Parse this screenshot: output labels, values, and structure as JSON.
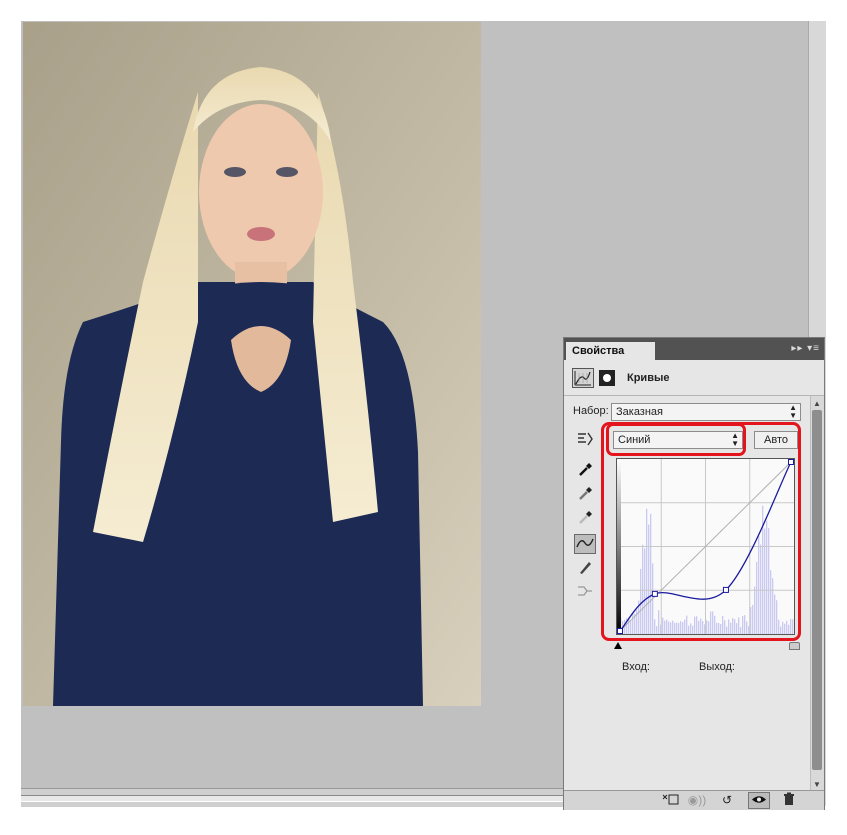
{
  "panel": {
    "tab_label": "Свойства",
    "menu_label": "▸▸ ▾≡",
    "title": "Кривые",
    "preset_label": "Набор:",
    "preset_value": "Заказная",
    "channel_value": "Синий",
    "auto_label": "Авто",
    "input_label": "Вход:",
    "output_label": "Выход:"
  },
  "curve": {
    "channel_color": "#1a1a9e",
    "points": [
      [
        0,
        0
      ],
      [
        52,
        56
      ],
      [
        158,
        62
      ],
      [
        255,
        255
      ]
    ]
  },
  "tools": [
    "targeted-adjust-icon",
    "black-point-eyedropper-icon",
    "gray-point-eyedropper-icon",
    "white-point-eyedropper-icon",
    "curve-points-icon",
    "pencil-icon",
    "smooth-icon"
  ],
  "footer_buttons": [
    "clip-to-layer-icon",
    "view-previous-icon",
    "reset-icon",
    "visibility-icon",
    "delete-icon"
  ],
  "highlight_color": "#e4141d"
}
